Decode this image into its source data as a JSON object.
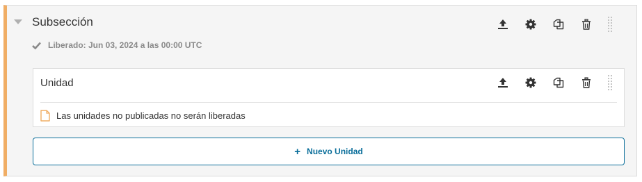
{
  "subsection": {
    "title": "Subsección",
    "release_status": "Liberado: Jun 03, 2024 a las 00:00 UTC",
    "actions": [
      "publish-icon",
      "gear-icon",
      "duplicate-icon",
      "trash-icon",
      "drag-handle-icon"
    ]
  },
  "unit": {
    "title": "Unidad",
    "note": "Las unidades no publicadas no serán liberadas",
    "actions": [
      "publish-icon",
      "gear-icon",
      "duplicate-icon",
      "trash-icon",
      "drag-handle-icon"
    ]
  },
  "new_unit_button": {
    "icon": "+",
    "label": "Nuevo Unidad"
  },
  "colors": {
    "section_accent": "#f0ad64",
    "primary": "#0a6e9a",
    "muted_text": "#8a8a8a",
    "note_icon": "#f0ad64"
  }
}
